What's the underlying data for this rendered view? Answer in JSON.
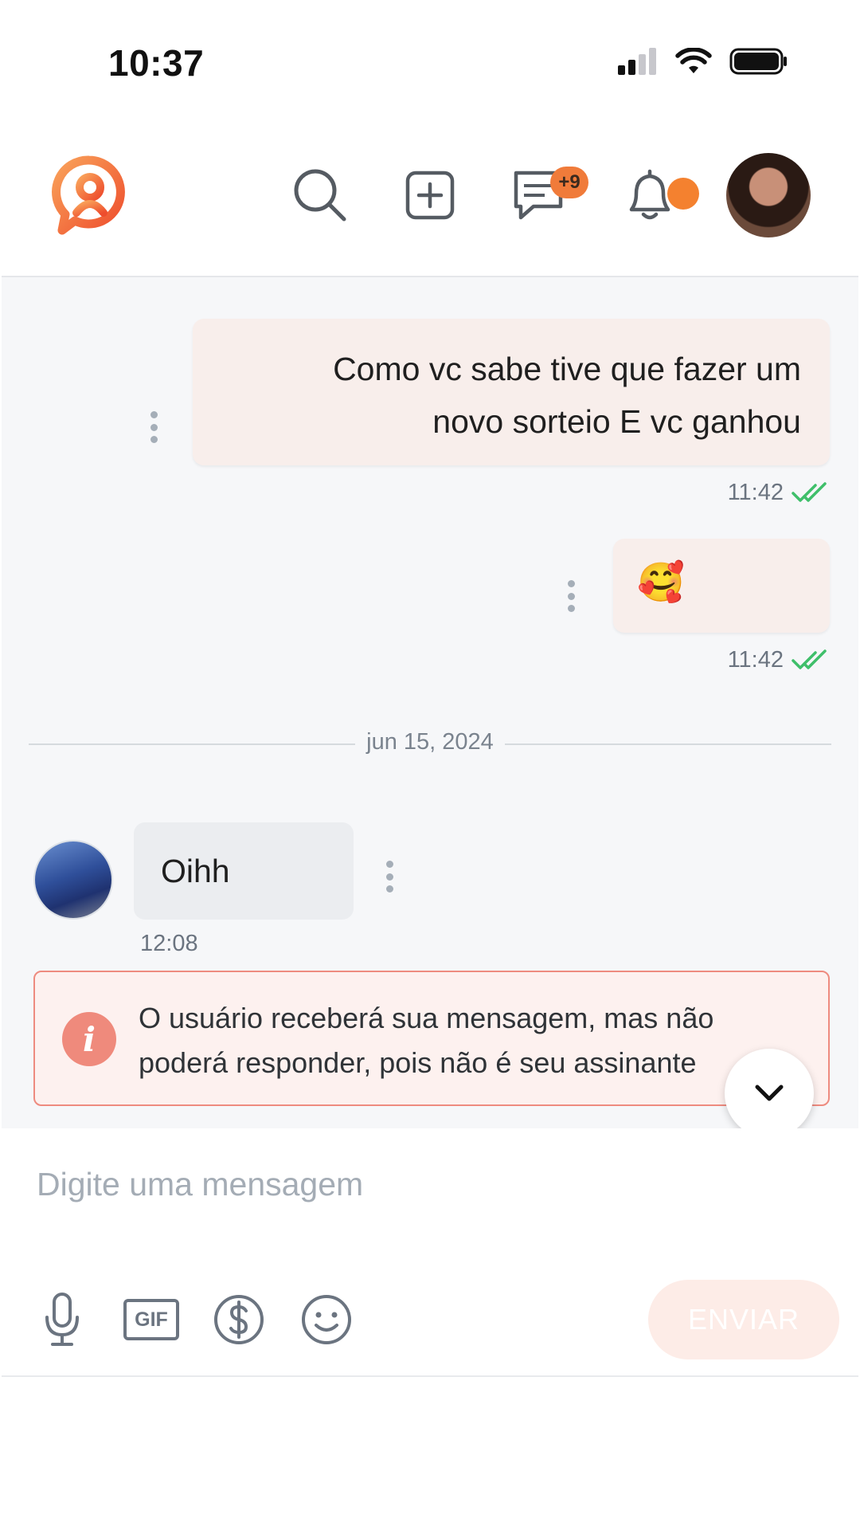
{
  "status_bar": {
    "time": "10:37"
  },
  "header": {
    "messages_badge": "+9"
  },
  "chat": {
    "messages": [
      {
        "direction": "out",
        "text_line1": "Como vc sabe tive que fazer um",
        "text_line2": "novo sorteio E vc ganhou",
        "time": "11:42"
      },
      {
        "direction": "out",
        "text": "🥰",
        "time": "11:42"
      },
      {
        "direction": "in",
        "text": "Oihh",
        "time": "12:08"
      }
    ],
    "date_divider": "jun 15, 2024",
    "warning": {
      "line1": "O usuário receberá sua mensagem, mas não",
      "line2": "poderá responder, pois não é seu assinante"
    }
  },
  "composer": {
    "placeholder": "Digite uma mensagem",
    "gif_label": "GIF",
    "send_label": "ENVIAR"
  },
  "colors": {
    "accent": "#f07b3a",
    "outgoing_bubble": "#f8eeeb",
    "incoming_bubble": "#ebedf0",
    "warning_border": "#ee8b7f",
    "read_check": "#3fbf6a"
  }
}
